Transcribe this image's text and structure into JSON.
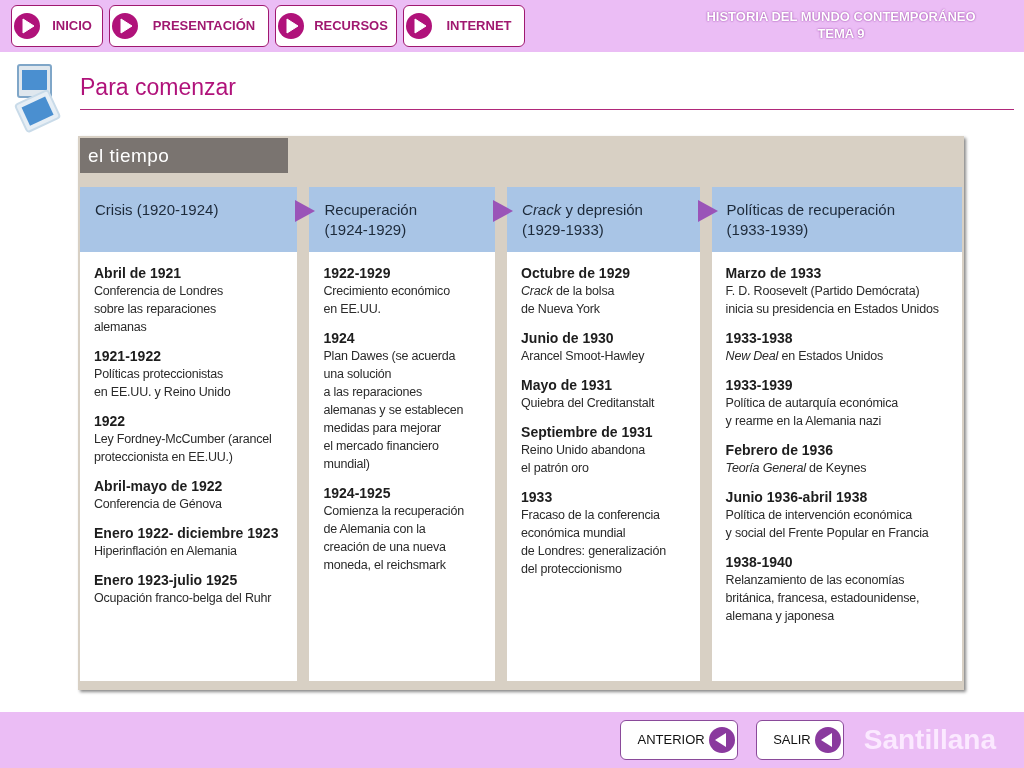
{
  "nav": [
    {
      "label": "INICIO"
    },
    {
      "label": "PRESENTACIÓN"
    },
    {
      "label": "RECURSOS"
    },
    {
      "label": "INTERNET"
    }
  ],
  "course": {
    "title": "HISTORIA DEL MUNDO CONTEMPORÁNEO",
    "unit": "TEMA 9"
  },
  "section_title": "Para comenzar",
  "panel": {
    "title": "el tiempo",
    "columns": [
      {
        "heading": "Crisis (1920-1924)",
        "entries": [
          {
            "date": "Abril de 1921",
            "text": "Conferencia de Londres\nsobre las reparaciones\nalemanas"
          },
          {
            "date": "1921-1922",
            "text": "Políticas proteccionistas\nen EE.UU. y Reino Unido"
          },
          {
            "date": "1922",
            "text": "Ley Fordney-McCumber (arancel\nproteccionista en EE.UU.)"
          },
          {
            "date": "Abril-mayo de 1922",
            "text": "Conferencia de Génova"
          },
          {
            "date": "Enero 1922- diciembre 1923",
            "text": "Hiperinflación en Alemania"
          },
          {
            "date": "Enero 1923-julio 1925",
            "text": "Ocupación franco-belga del Ruhr"
          }
        ]
      },
      {
        "heading": "Recuperación\n(1924-1929)",
        "entries": [
          {
            "date": "1922-1929",
            "text": "Crecimiento económico\nen EE.UU."
          },
          {
            "date": "1924",
            "text": "Plan Dawes (se acuerda\nuna solución\na las reparaciones\nalemanas y se establecen\nmedidas para mejorar\nel mercado financiero\nmundial)"
          },
          {
            "date": "1924-1925",
            "text": "Comienza la recuperación\nde Alemania con la\ncreación de una nueva\nmoneda, el reichsmark"
          }
        ]
      },
      {
        "heading": "*Crack* y depresión\n(1929-1933)",
        "entries": [
          {
            "date": "Octubre de 1929",
            "text": "*Crack* de la bolsa\nde Nueva York"
          },
          {
            "date": "Junio de 1930",
            "text": "Arancel Smoot-Hawley"
          },
          {
            "date": "Mayo de 1931",
            "text": "Quiebra del Creditanstalt"
          },
          {
            "date": "Septiembre de 1931",
            "text": "Reino Unido abandona\nel patrón oro"
          },
          {
            "date": "1933",
            "text": "Fracaso de la conferencia\neconómica mundial\nde Londres: generalización\ndel proteccionismo"
          }
        ]
      },
      {
        "heading": "Políticas de recuperación\n(1933-1939)",
        "entries": [
          {
            "date": "Marzo de 1933",
            "text": "F. D. Roosevelt (Partido Demócrata)\ninicia su presidencia en Estados Unidos"
          },
          {
            "date": "1933-1938",
            "text": "*New Deal* en Estados Unidos"
          },
          {
            "date": "1933-1939",
            "text": "Política de autarquía económica\ny rearme en la Alemania nazi"
          },
          {
            "date": "Febrero de 1936",
            "text": "*Teoría General* de Keynes"
          },
          {
            "date": "Junio 1936-abril 1938",
            "text": "Política de intervención económica\ny social del Frente Popular en Francia"
          },
          {
            "date": "1938-1940",
            "text": "Relanzamiento de las economías\nbritánica, francesa, estadounidense,\nalemana y japonesa"
          }
        ]
      }
    ]
  },
  "footer": {
    "buttons": [
      {
        "label": "ANTERIOR"
      },
      {
        "label": "SALIR"
      }
    ],
    "brand": "Santillana"
  }
}
